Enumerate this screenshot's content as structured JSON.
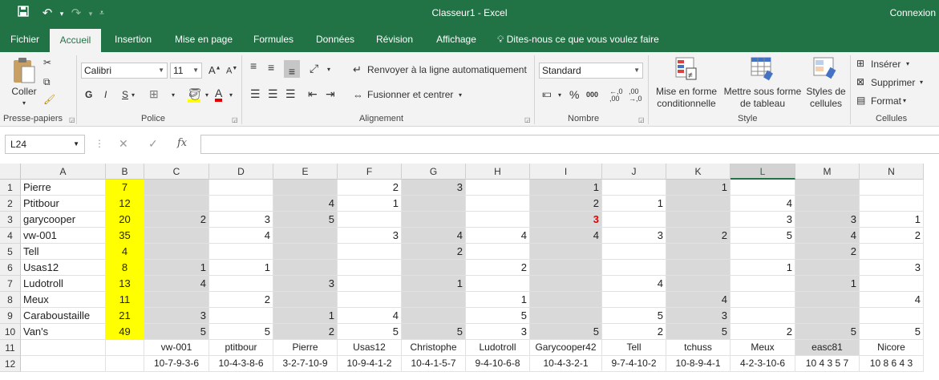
{
  "app": {
    "title": "Classeur1 - Excel",
    "signin": "Connexion",
    "qat": {
      "save_icon": "save-icon",
      "undo_icon": "undo-icon",
      "redo_icon": "redo-icon",
      "customize_icon": "customize-qat-icon"
    }
  },
  "tabs": [
    {
      "label": "Fichier"
    },
    {
      "label": "Accueil",
      "active": true
    },
    {
      "label": "Insertion"
    },
    {
      "label": "Mise en page"
    },
    {
      "label": "Formules"
    },
    {
      "label": "Données"
    },
    {
      "label": "Révision"
    },
    {
      "label": "Affichage"
    }
  ],
  "tell_me": "Dites-nous ce que vous voulez faire",
  "ribbon": {
    "clipboard": {
      "paste": "Coller",
      "group": "Presse-papiers"
    },
    "font": {
      "name": "Calibri",
      "size": "11",
      "group": "Police",
      "bold": "G",
      "italic": "I",
      "underline": "S",
      "grow": "A",
      "shrink": "A",
      "color_a": "A"
    },
    "alignment": {
      "wrap": "Renvoyer à la ligne automatiquement",
      "merge": "Fusionner et centrer",
      "group": "Alignement"
    },
    "number": {
      "format": "Standard",
      "group": "Nombre",
      "percent": "%",
      "thousands": "000"
    },
    "styles": {
      "conditional": "Mise en forme conditionnelle",
      "table": "Mettre sous forme de tableau",
      "cell_styles": "Styles de cellules",
      "group": "Style"
    },
    "cells": {
      "insert": "Insérer",
      "delete": "Supprimer",
      "format": "Format",
      "group": "Cellules"
    }
  },
  "formula_bar": {
    "name_box": "L24",
    "fx": "fx",
    "formula": ""
  },
  "columns": [
    "A",
    "B",
    "C",
    "D",
    "E",
    "F",
    "G",
    "H",
    "I",
    "J",
    "K",
    "L",
    "M",
    "N"
  ],
  "selected_column": "L",
  "colors": {
    "accent": "#217346",
    "highlight": "#ffff00",
    "shade": "#d9d9d9",
    "alert": "#e00000"
  },
  "rows": [
    {
      "n": "1",
      "A": "Pierre",
      "B": "7",
      "C": "",
      "D": "",
      "E": "",
      "F": "2",
      "G": "3",
      "H": "",
      "I": "1",
      "J": "",
      "K": "1",
      "L": "",
      "M": "",
      "N": ""
    },
    {
      "n": "2",
      "A": "Ptitbour",
      "B": "12",
      "C": "",
      "D": "",
      "E": "4",
      "F": "1",
      "G": "",
      "H": "",
      "I": "2",
      "J": "1",
      "K": "",
      "L": "4",
      "M": "",
      "N": ""
    },
    {
      "n": "3",
      "A": "garycooper",
      "B": "20",
      "C": "2",
      "D": "3",
      "E": "5",
      "F": "",
      "G": "",
      "H": "",
      "I": "3",
      "J": "",
      "K": "",
      "L": "3",
      "M": "3",
      "N": "1"
    },
    {
      "n": "4",
      "A": "vw-001",
      "B": "35",
      "C": "",
      "D": "4",
      "E": "",
      "F": "3",
      "G": "4",
      "H": "4",
      "I": "4",
      "J": "3",
      "K": "2",
      "L": "5",
      "M": "4",
      "N": "2"
    },
    {
      "n": "5",
      "A": "Tell",
      "B": "4",
      "C": "",
      "D": "",
      "E": "",
      "F": "",
      "G": "2",
      "H": "",
      "I": "",
      "J": "",
      "K": "",
      "L": "",
      "M": "2",
      "N": ""
    },
    {
      "n": "6",
      "A": "Usas12",
      "B": "8",
      "C": "1",
      "D": "1",
      "E": "",
      "F": "",
      "G": "",
      "H": "2",
      "I": "",
      "J": "",
      "K": "",
      "L": "1",
      "M": "",
      "N": "3"
    },
    {
      "n": "7",
      "A": "Ludotroll",
      "B": "13",
      "C": "4",
      "D": "",
      "E": "3",
      "F": "",
      "G": "1",
      "H": "",
      "I": "",
      "J": "4",
      "K": "",
      "L": "",
      "M": "1",
      "N": ""
    },
    {
      "n": "8",
      "A": "Meux",
      "B": "11",
      "C": "",
      "D": "2",
      "E": "",
      "F": "",
      "G": "",
      "H": "1",
      "I": "",
      "J": "",
      "K": "4",
      "L": "",
      "M": "",
      "N": "4"
    },
    {
      "n": "9",
      "A": "Caraboustaille",
      "B": "21",
      "C": "3",
      "D": "",
      "E": "1",
      "F": "4",
      "G": "",
      "H": "5",
      "I": "",
      "J": "5",
      "K": "3",
      "L": "",
      "M": "",
      "N": ""
    },
    {
      "n": "10",
      "A": "Van's",
      "B": "49",
      "C": "5",
      "D": "5",
      "E": "2",
      "F": "5",
      "G": "5",
      "H": "3",
      "I": "5",
      "J": "2",
      "K": "5",
      "L": "2",
      "M": "5",
      "N": "5"
    },
    {
      "n": "11",
      "A": "",
      "B": "",
      "C": "vw-001",
      "D": "ptitbour",
      "E": "Pierre",
      "F": "Usas12",
      "G": "Christophe",
      "H": "Ludotroll",
      "I": "Garycooper42",
      "J": "Tell",
      "K": "tchuss",
      "L": "Meux",
      "M": "easc81",
      "N": "Nicore"
    },
    {
      "n": "12",
      "A": "",
      "B": "",
      "C": "10-7-9-3-6",
      "D": "10-4-3-8-6",
      "E": "3-2-7-10-9",
      "F": "10-9-4-1-2",
      "G": "10-4-1-5-7",
      "H": "9-4-10-6-8",
      "I": "10-4-3-2-1",
      "J": "9-7-4-10-2",
      "K": "10-8-9-4-1",
      "L": "4-2-3-10-6",
      "M": "10 4 3 5 7",
      "N": "10 8 6 4 3"
    }
  ]
}
